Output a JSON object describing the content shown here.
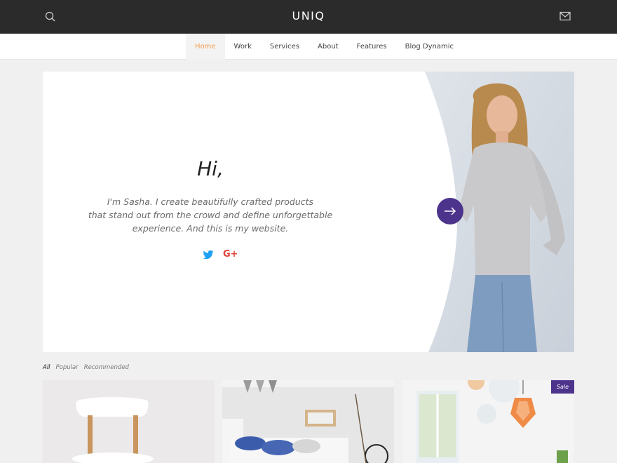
{
  "header": {
    "logo": "UNIQ",
    "search_icon": "search-icon",
    "mail_icon": "mail-icon"
  },
  "nav": {
    "items": [
      {
        "label": "Home",
        "active": true
      },
      {
        "label": "Work"
      },
      {
        "label": "Services"
      },
      {
        "label": "About"
      },
      {
        "label": "Features"
      },
      {
        "label": "Blog Dynamic"
      }
    ]
  },
  "hero": {
    "greeting": "Hi,",
    "intro_lines": [
      "I'm Sasha. I create beautifully crafted products",
      "that stand out from the crowd and define unforgettable",
      "experience. And this is my website."
    ],
    "social": {
      "twitter_icon": "twitter-icon",
      "googleplus_label": "G+"
    },
    "next_icon": "arrow-right-icon"
  },
  "filters": [
    "All",
    "Popular",
    "Recommended"
  ],
  "cards": [
    {
      "name": "chair",
      "badge": ""
    },
    {
      "name": "bedroom",
      "badge": ""
    },
    {
      "name": "lamps",
      "badge": "Sale"
    }
  ],
  "colors": {
    "header_bg": "#2b2b2b",
    "accent_orange": "#f49a4a",
    "accent_purple": "#4c338c",
    "twitter_blue": "#1da1f2",
    "googleplus_red": "#e0453a"
  }
}
